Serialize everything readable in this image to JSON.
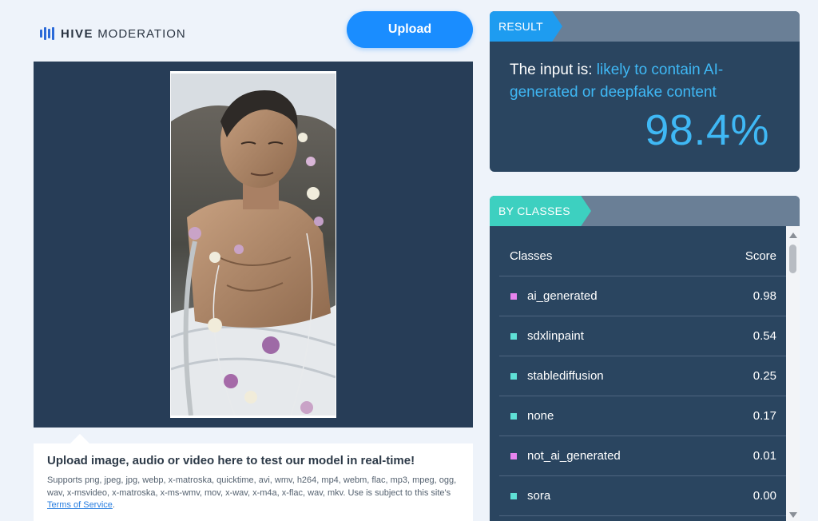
{
  "brand": {
    "name_bold": "HIVE",
    "name_light": "MODERATION",
    "accent": "#2b6ad8"
  },
  "toolbar": {
    "upload_label": "Upload"
  },
  "upload_info": {
    "title": "Upload image, audio or video here to test our model in real-time!",
    "description": "Supports png, jpeg, jpg, webp, x-matroska, quicktime, avi, wmv, h264, mp4, webm, flac, mp3, mpeg, ogg, wav, x-msvideo, x-matroska, x-ms-wmv, mov, x-wav, x-m4a, x-flac, wav, mkv. Use is subject to this site's ",
    "link_text": "Terms of Service",
    "suffix": "."
  },
  "result": {
    "tag": "RESULT",
    "prefix": "The input is: ",
    "verdict": "likely to contain AI-generated or deepfake content",
    "percent": "98.4%"
  },
  "classes": {
    "tag": "BY CLASSES",
    "header": {
      "classes": "Classes",
      "score": "Score"
    },
    "rows": [
      {
        "name": "ai_generated",
        "score": "0.98",
        "color": "#e784ef"
      },
      {
        "name": "sdxlinpaint",
        "score": "0.54",
        "color": "#5fe0d6"
      },
      {
        "name": "stablediffusion",
        "score": "0.25",
        "color": "#5fe0d6"
      },
      {
        "name": "none",
        "score": "0.17",
        "color": "#5fe0d6"
      },
      {
        "name": "not_ai_generated",
        "score": "0.01",
        "color": "#e784ef"
      },
      {
        "name": "sora",
        "score": "0.00",
        "color": "#5fe0d6"
      }
    ]
  },
  "colors": {
    "panel": "#2a4560",
    "upload_button": "#1a8dff",
    "result_tag": "#1e9cf0",
    "classes_tag": "#3dd0c0",
    "verdict": "#3fb8f5"
  }
}
